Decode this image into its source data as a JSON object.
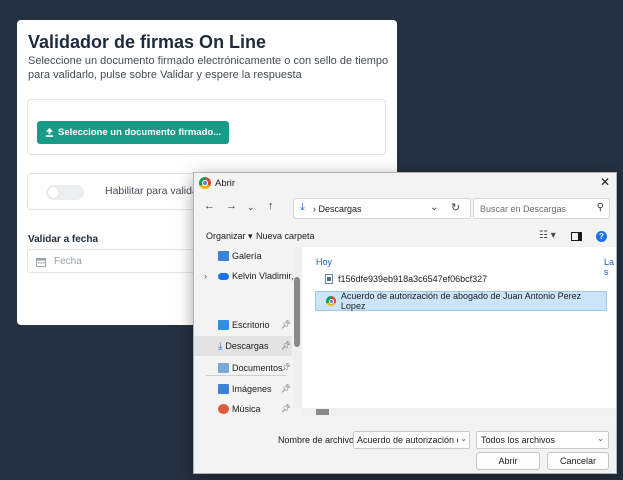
{
  "page": {
    "title": "Validador de firmas On Line",
    "description": "Seleccione un documento firmado electrónicamente o con sello de tiempo para validarlo, pulse sobre Validar y espere la respuesta",
    "upload_button": "Seleccione un documento firmado...",
    "toggle_label": "Habilitar para validar firma",
    "date_label": "Validar a fecha",
    "date_placeholder": "Fecha",
    "accent_color": "#1a9b87"
  },
  "dialog": {
    "title": "Abrir",
    "address": "Descargas",
    "search_placeholder": "Buscar en Descargas",
    "toolbar": {
      "organize": "Organizar",
      "new_folder": "Nueva carpeta"
    },
    "nav": {
      "gallery": "Galería",
      "onedrive": "Kelvin Vladimir,",
      "desktop": "Escritorio",
      "downloads": "Descargas",
      "documents": "Documentos",
      "pictures": "Imágenes",
      "music": "Música"
    },
    "group": "Hoy",
    "group_more": "La s",
    "files": [
      {
        "name": "f156dfe939eb918a3c6547ef06bcf327",
        "icon": "document-icon",
        "selected": false
      },
      {
        "name": "Acuerdo de autorización de abogado de Juan Antonio Perez Lopez",
        "icon": "chrome-icon",
        "selected": true
      }
    ],
    "filename_label": "Nombre de archivo:",
    "filename_value": "Acuerdo de autorización de abogado de Juan Antonio Perez Lopez",
    "filetype": "Todos los archivos",
    "open_button": "Abrir",
    "cancel_button": "Cancelar"
  }
}
